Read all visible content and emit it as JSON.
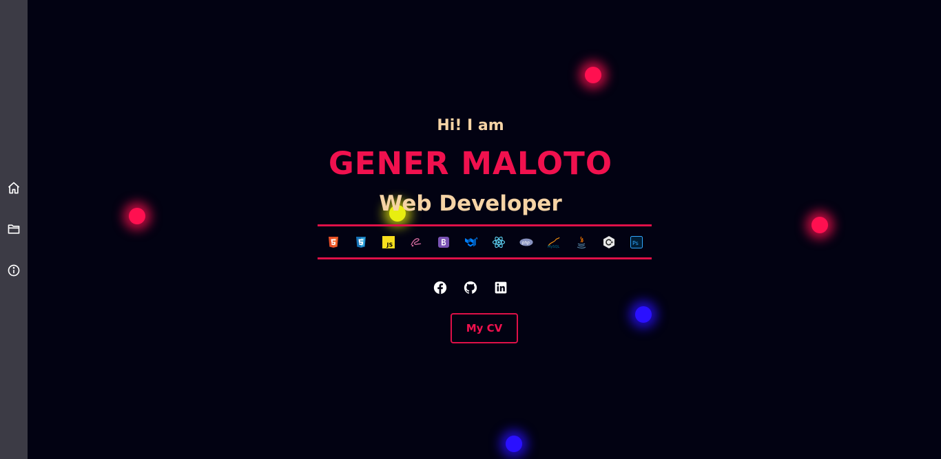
{
  "sidebar": {
    "items": [
      {
        "icon": "home-icon",
        "label": ""
      },
      {
        "icon": "folder-icon",
        "label": ""
      },
      {
        "icon": "info-icon",
        "label": ""
      }
    ]
  },
  "hero": {
    "greeting": "Hi! I am",
    "name": "GENER MALOTO",
    "role": "Web Developer"
  },
  "skills": [
    "html5-icon",
    "css3-icon",
    "javascript-icon",
    "sass-icon",
    "bootstrap-icon",
    "material-ui-icon",
    "react-icon",
    "php-icon",
    "mysql-icon",
    "java-icon",
    "csharp-icon",
    "photoshop-icon"
  ],
  "socials": [
    "facebook-icon",
    "github-icon",
    "linkedin-icon"
  ],
  "cv_button": {
    "label": "My CV"
  },
  "colors": {
    "background": "#020212",
    "sidebar": "#3c3b45",
    "accent": "#f0114e",
    "text_cream": "#f5d3a5",
    "glow_red": "#ff1050",
    "glow_blue": "#2a10ff",
    "glow_yellow": "#e8ee10"
  }
}
